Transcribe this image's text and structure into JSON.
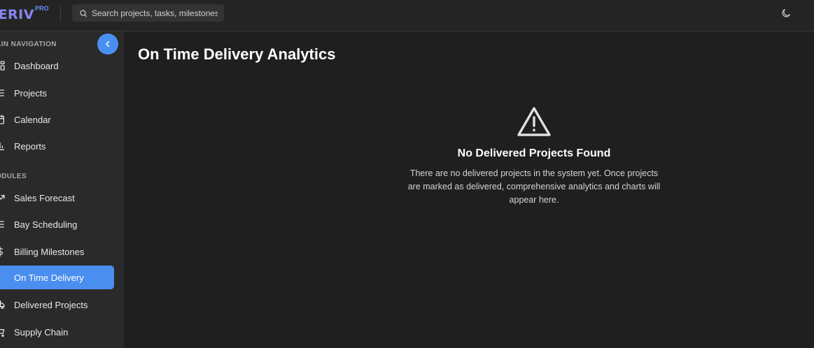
{
  "app": {
    "logo_text": "IERIV",
    "logo_badge": "PRO"
  },
  "search": {
    "placeholder": "Search projects, tasks, milestones..."
  },
  "sidebar": {
    "main_nav_label": "AIN NAVIGATION",
    "main_items": [
      {
        "label": "Dashboard",
        "icon": "dashboard-icon"
      },
      {
        "label": "Projects",
        "icon": "list-icon"
      },
      {
        "label": "Calendar",
        "icon": "calendar-icon"
      },
      {
        "label": "Reports",
        "icon": "bar-chart-icon"
      }
    ],
    "modules_label": "ODULES",
    "module_items": [
      {
        "label": "Sales Forecast",
        "icon": "trending-up-icon"
      },
      {
        "label": "Bay Scheduling",
        "icon": "list-icon"
      },
      {
        "label": "Billing Milestones",
        "icon": "dollar-icon"
      },
      {
        "label": "On Time Delivery",
        "icon": "clock-icon",
        "active": true
      },
      {
        "label": "Delivered Projects",
        "icon": "truck-icon"
      },
      {
        "label": "Supply Chain",
        "icon": "cart-icon"
      }
    ]
  },
  "main": {
    "title": "On Time Delivery Analytics",
    "empty_state": {
      "icon": "warning-icon",
      "heading": "No Delivered Projects Found",
      "message": "There are no delivered projects in the system yet. Once projects are marked as delivered, comprehensive analytics and charts will appear here."
    }
  },
  "colors": {
    "accent": "#4a8ef0",
    "background": "#1f1f1f",
    "sidebar": "#2a2a2a",
    "topbar": "#242424"
  }
}
